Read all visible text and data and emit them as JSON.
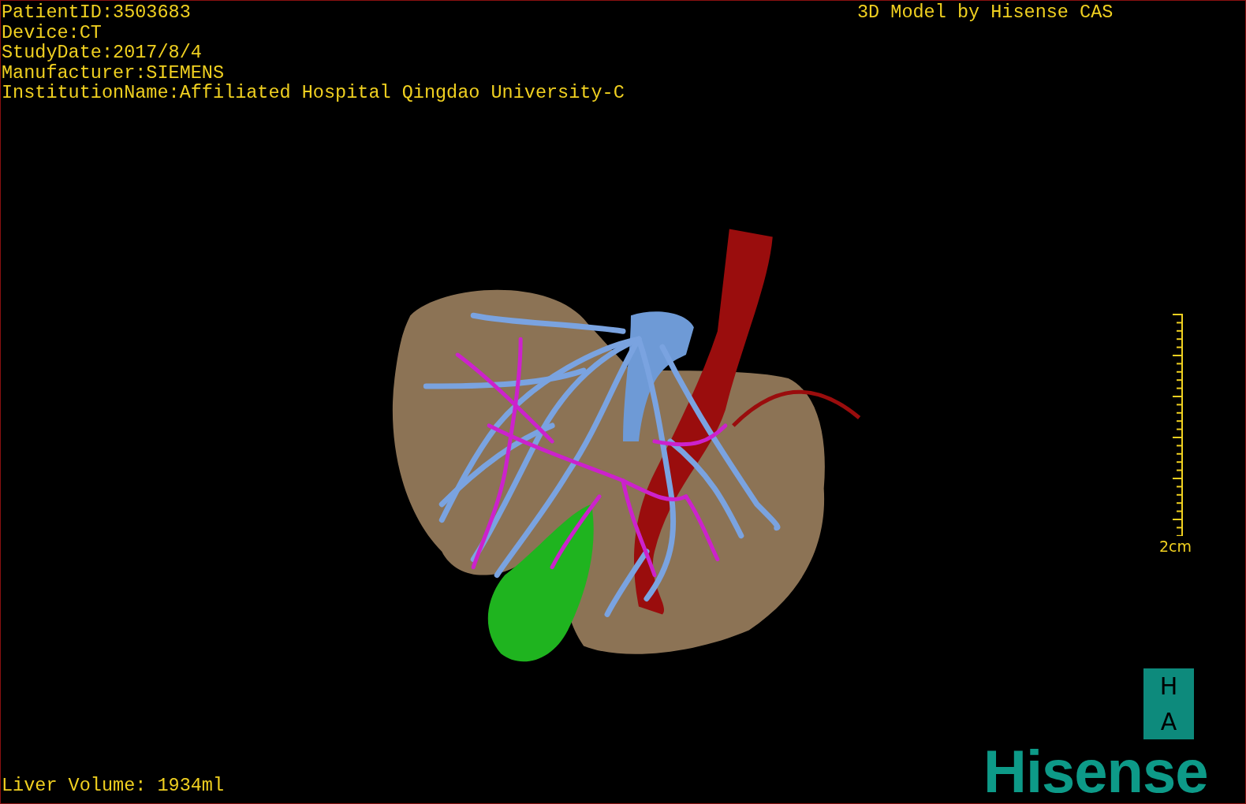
{
  "study_info": [
    {
      "text": "PatientID:3503683"
    },
    {
      "text": "Device:CT"
    },
    {
      "text": "StudyDate:2017/8/4"
    },
    {
      "text": "Manufacturer:SIEMENS"
    },
    {
      "text": "InstitutionName:Affiliated Hospital Qingdao University-C"
    }
  ],
  "model_title": "3D Model by Hisense CAS",
  "scale_bar": {
    "label": "2cm"
  },
  "orientation": {
    "top": "H",
    "bottom": "A"
  },
  "logo": "Hisense",
  "liver_volume": "Liver Volume: 1934ml"
}
